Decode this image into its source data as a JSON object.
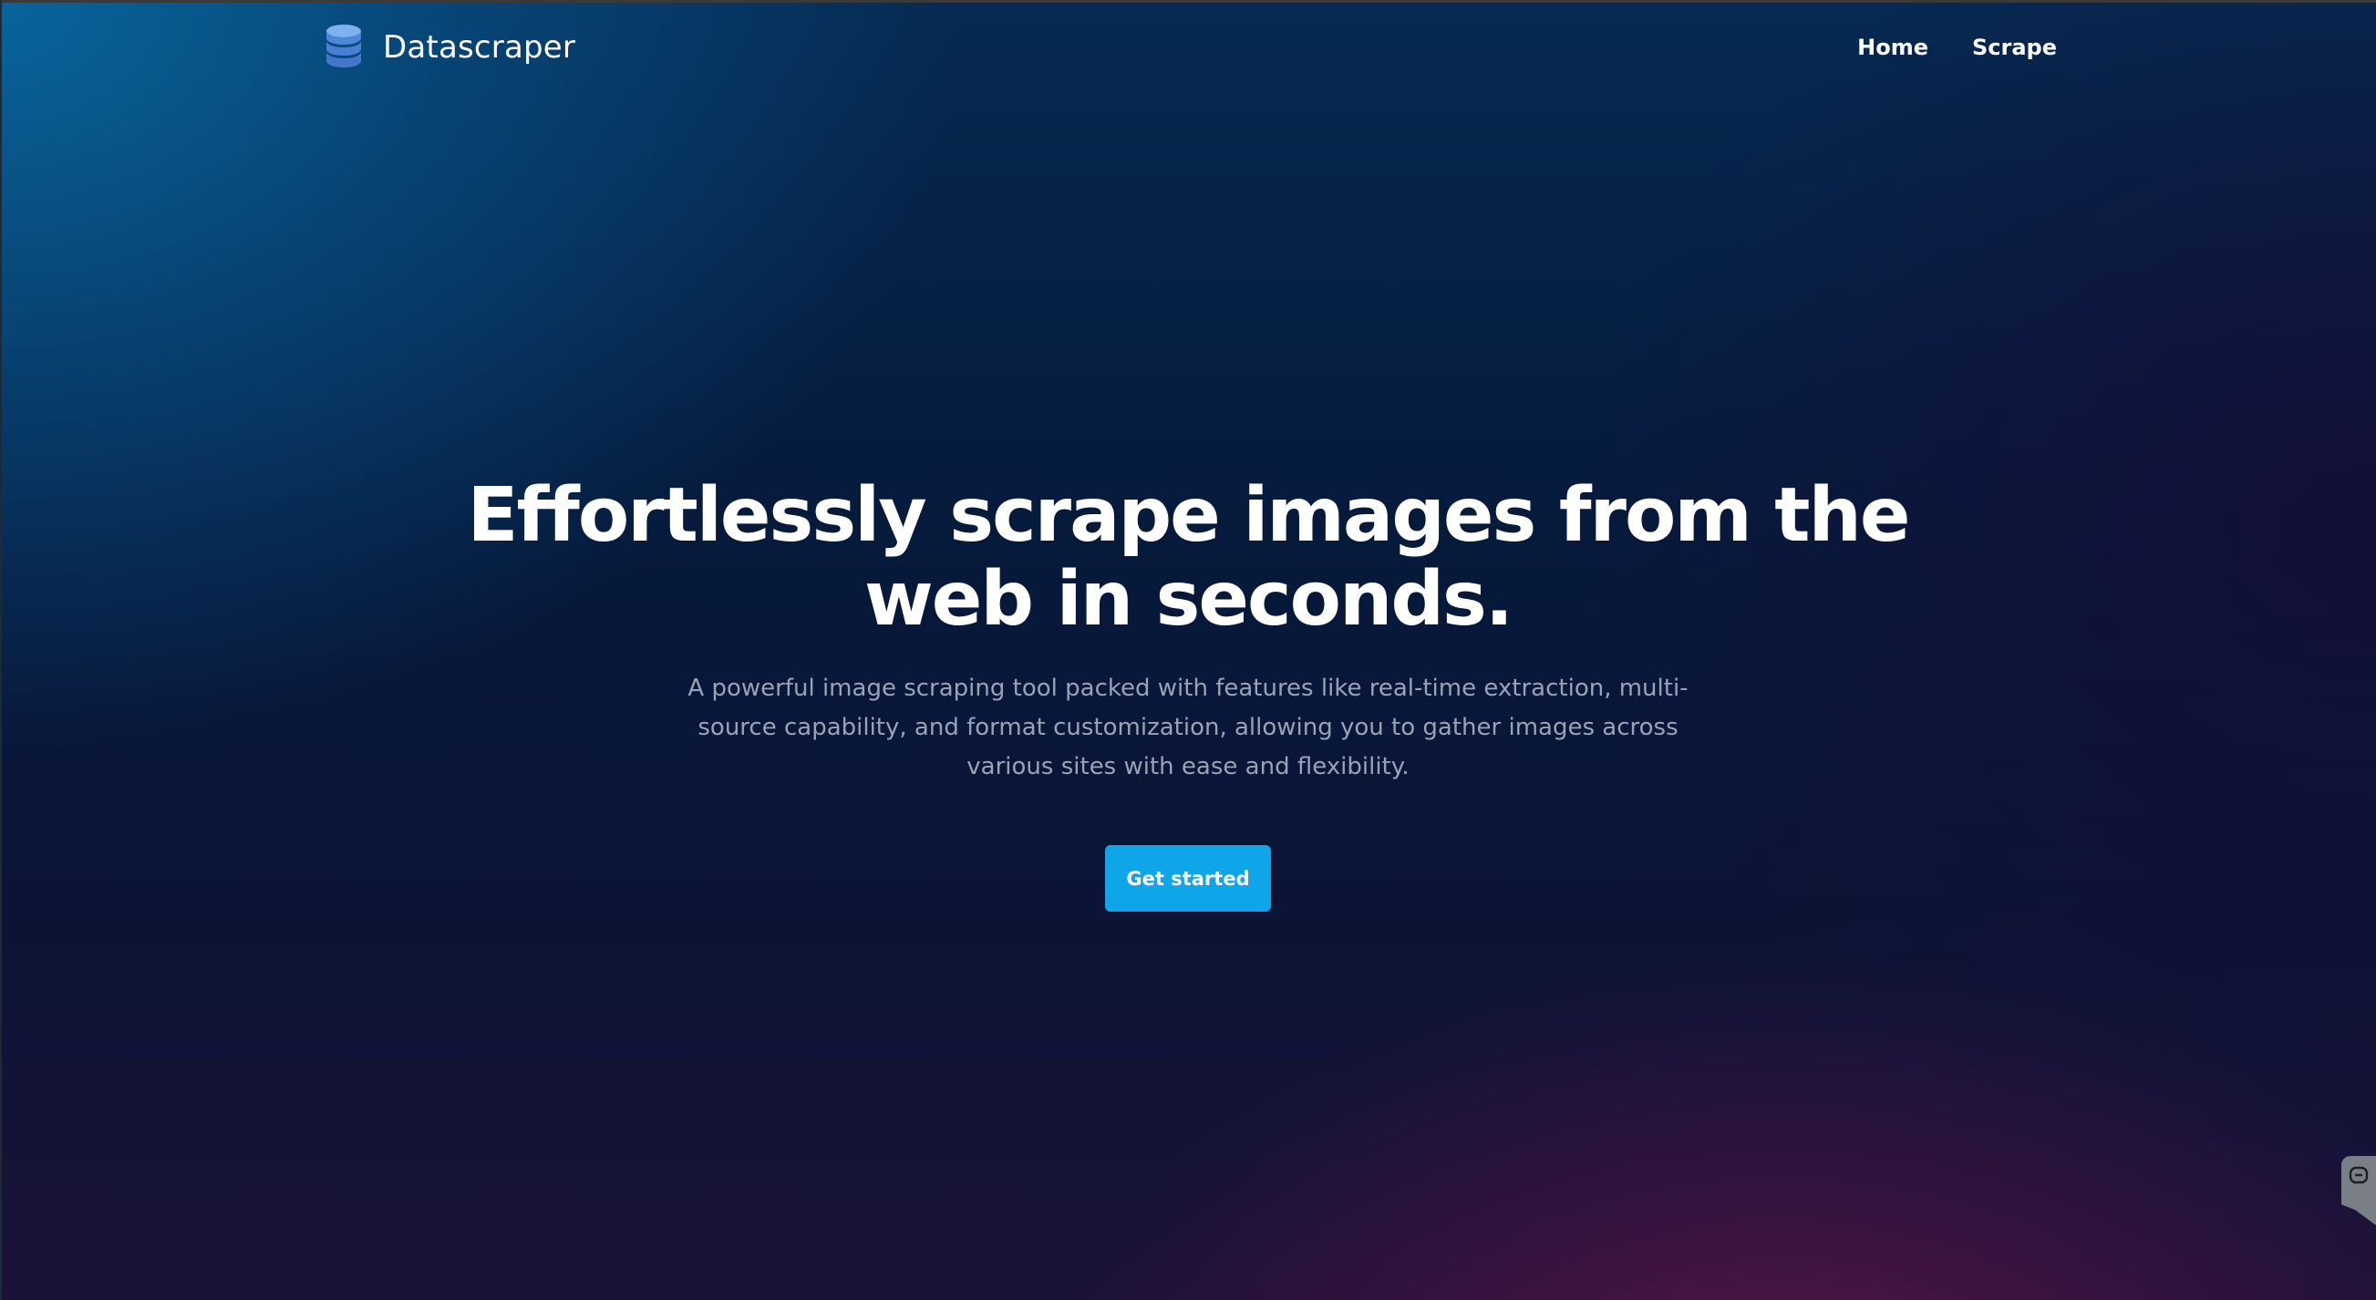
{
  "header": {
    "brand_name": "Datascraper",
    "brand_icon": "database-icon",
    "nav": [
      {
        "label": "Home"
      },
      {
        "label": "Scrape"
      }
    ]
  },
  "hero": {
    "title_line1": "Effortlessly scrape images from the",
    "title_line2": "web in seconds.",
    "subtitle": "A powerful image scraping tool packed with features like real-time extraction, multi-source capability, and format customization, allowing you to gather images across various sites with ease and flexibility.",
    "cta_label": "Get started"
  },
  "side_widget": {
    "icon": "chat-widget-icon"
  },
  "colors": {
    "accent": "#0ea5e9",
    "subtitle_text": "#9aa3b6",
    "brand_icon": "#4f86d9"
  }
}
